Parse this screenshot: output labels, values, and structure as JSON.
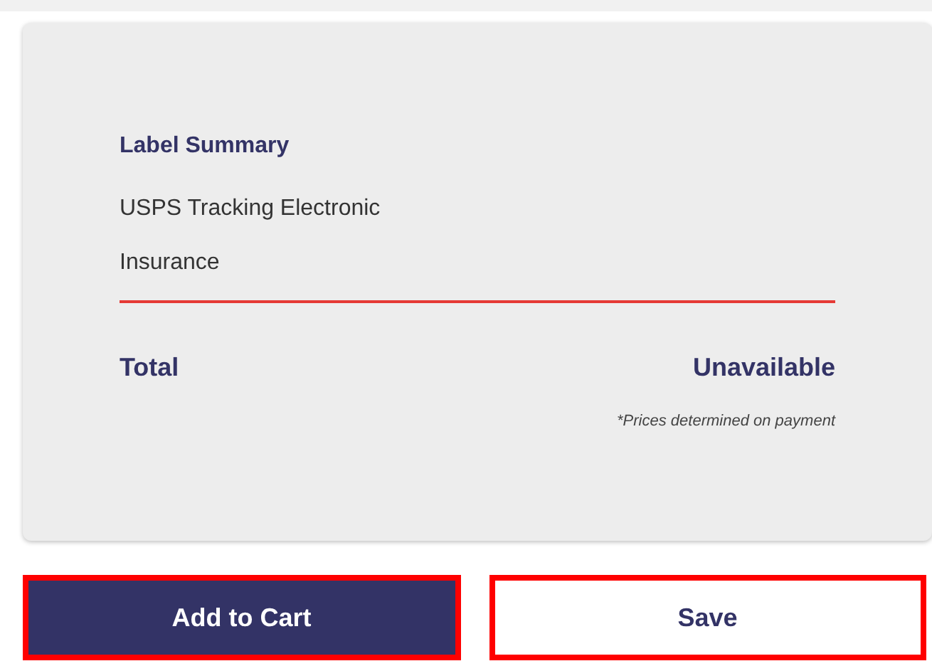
{
  "summary": {
    "title": "Label Summary",
    "items": [
      "USPS Tracking Electronic",
      "Insurance"
    ],
    "total_label": "Total",
    "total_value": "Unavailable",
    "note": "*Prices determined on payment"
  },
  "buttons": [
    {
      "label": "Add to Cart",
      "kind": "primary",
      "highlighted": true
    },
    {
      "label": "Save",
      "kind": "secondary",
      "highlighted": true
    }
  ]
}
